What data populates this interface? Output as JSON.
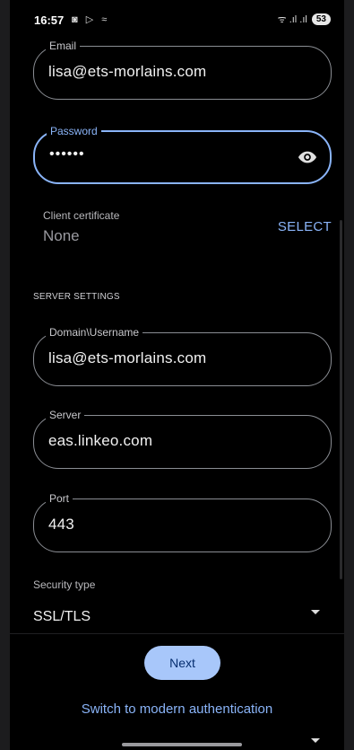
{
  "status": {
    "time": "16:57",
    "icons": "◙ ▷ ≈",
    "signal": "ᯤ .ıl .ıl",
    "battery": "53"
  },
  "form": {
    "email": {
      "label": "Email",
      "value": "lisa@ets-morlains.com"
    },
    "password": {
      "label": "Password",
      "value": "••••••"
    },
    "certificate": {
      "label": "Client certificate",
      "value": "None",
      "action": "SELECT"
    },
    "section_header": "SERVER SETTINGS",
    "domain_username": {
      "label": "Domain\\Username",
      "value": "lisa@ets-morlains.com"
    },
    "server": {
      "label": "Server",
      "value": "eas.linkeo.com"
    },
    "port": {
      "label": "Port",
      "value": "443"
    },
    "security_type": {
      "label": "Security type",
      "value": "SSL/TLS"
    }
  },
  "footer": {
    "next_label": "Next",
    "switch_label": "Switch to modern authentication"
  },
  "colors": {
    "accent": "#8ab4f8",
    "button_bg": "#a8c7fa",
    "background": "#000000"
  }
}
